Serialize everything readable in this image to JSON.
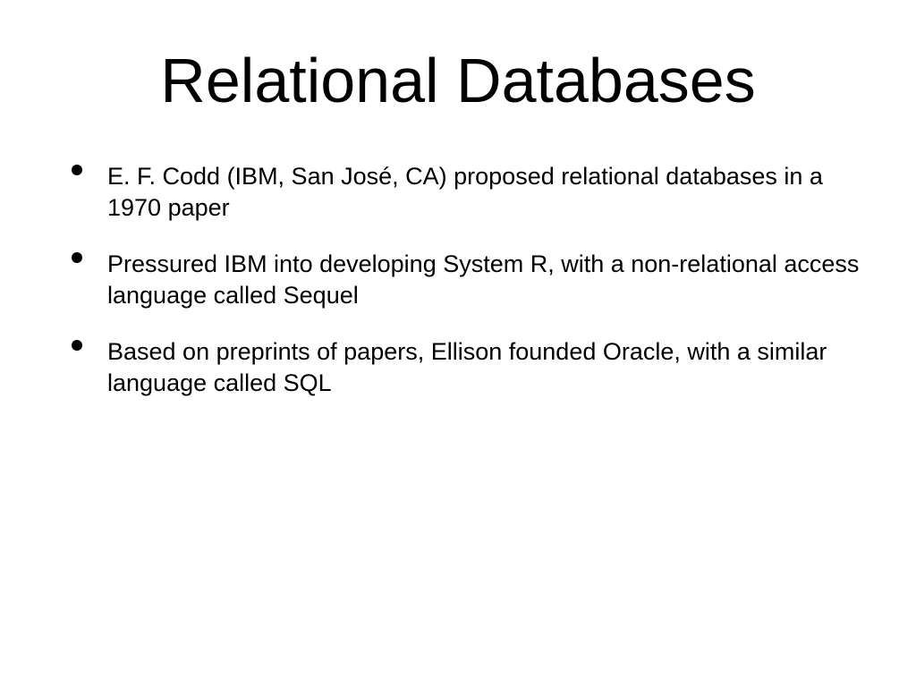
{
  "slide": {
    "title": "Relational Databases",
    "bullets": [
      "E. F. Codd (IBM, San José, CA) proposed relational databases in a 1970 paper",
      "Pressured IBM into developing System R, with a non-relational access language called Sequel",
      "Based on preprints of papers, Ellison founded Oracle, with a similar language called SQL"
    ]
  }
}
